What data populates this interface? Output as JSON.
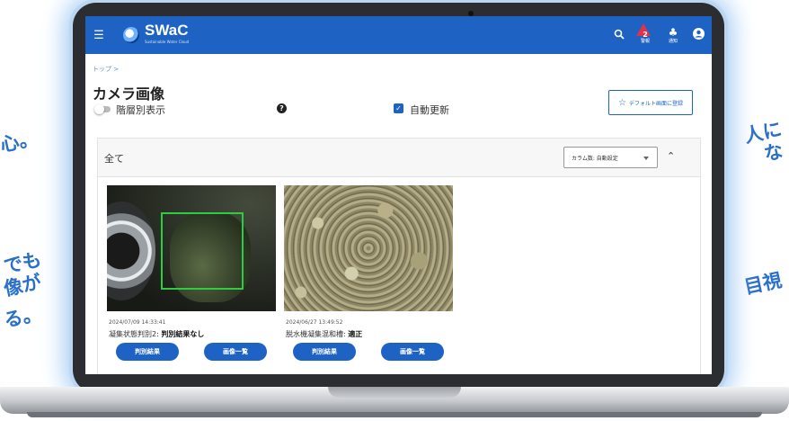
{
  "side_text": {
    "left_top": "心。",
    "left_mid_1": "でも",
    "left_mid_2": "像が",
    "left_mid_3": "る。",
    "right_top_1": "人に",
    "right_top_2": "な",
    "right_mid": "目視"
  },
  "app": {
    "logo_name": "SWaC",
    "logo_sub": "Sustainable Water Cloud",
    "warning_count": "2",
    "warning_label": "警報",
    "notify_label": "通知"
  },
  "breadcrumb": "トップ >",
  "page_title": "カメラ画像",
  "controls": {
    "hierarchy_label": "階層別表示",
    "help_glyph": "?",
    "auto_update_label": "自動更新",
    "default_button_label": "デフォルト画面に登録"
  },
  "panel": {
    "all_label": "全て",
    "column_select_value": "カラム数: 自動設定"
  },
  "cards": [
    {
      "date": "2024/07/09 14:33:41",
      "desc_label": "凝集状態判別2:",
      "desc_value": "判別結果なし",
      "btn_result": "判別結果",
      "btn_list": "画像一覧"
    },
    {
      "date": "2024/06/27 13:49:52",
      "desc_label": "脱水機凝集混和槽:",
      "desc_value": "適正",
      "btn_result": "判別結果",
      "btn_list": "画像一覧"
    }
  ],
  "colors": {
    "primary": "#1e63c4",
    "box_detect": "#2ecc40",
    "warning": "#e0334b",
    "side_text": "#2a6fc9"
  }
}
